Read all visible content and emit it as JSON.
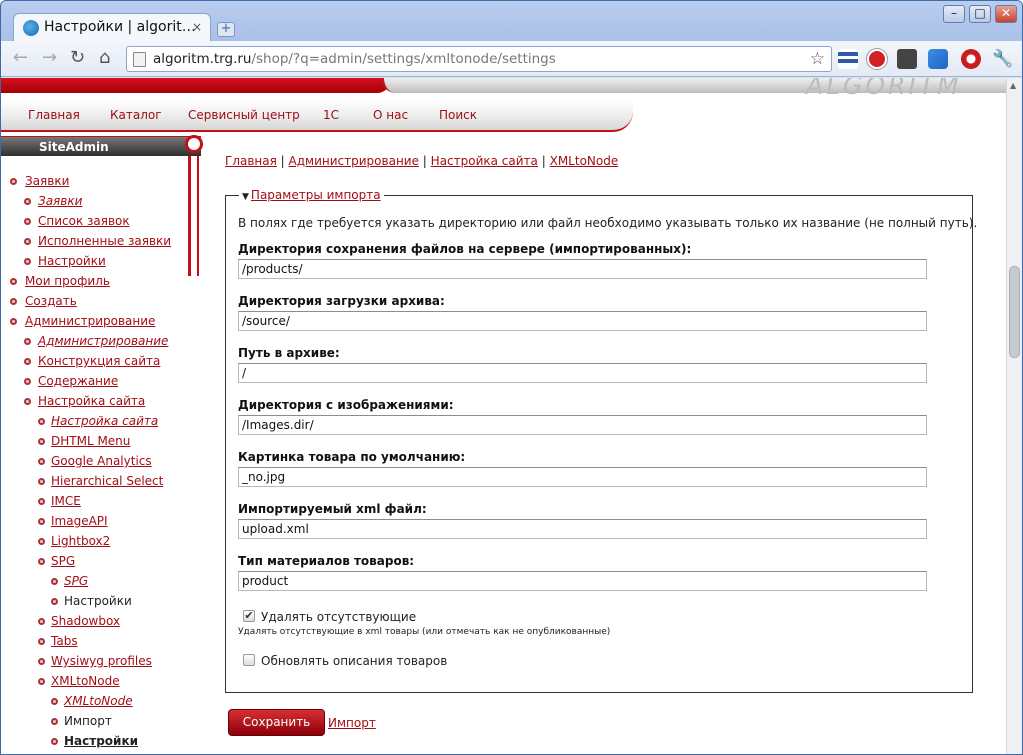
{
  "browser": {
    "tab_title": "Настройки | algorit…",
    "tab_close": "×",
    "new_tab": "+",
    "url_host": "algoritm.trg.ru",
    "url_path": "/shop/?q=admin/settings/xmltonode/settings",
    "window_controls": [
      "minimize-icon",
      "maximize-icon",
      "close-icon"
    ],
    "nav_icons": [
      "back-icon",
      "forward-icon",
      "reload-icon",
      "home-icon"
    ],
    "extension_icons": [
      "menu-bars-icon",
      "adblock-icon",
      "camera-icon",
      "dropbox-icon",
      "opera-icon",
      "wrench-icon"
    ]
  },
  "site": {
    "logo_text": "ALGORITM",
    "menu": [
      "Главная",
      "Каталог",
      "Сервисный центр",
      "1С",
      "О нас",
      "Поиск"
    ]
  },
  "sidebar": {
    "title": "SiteAdmin",
    "items": [
      {
        "label": "Заявки",
        "level": 0,
        "style": "normal"
      },
      {
        "label": "Заявки",
        "level": 1,
        "style": "italic"
      },
      {
        "label": "Список заявок",
        "level": 1,
        "style": "normal"
      },
      {
        "label": "Исполненные заявки",
        "level": 1,
        "style": "normal"
      },
      {
        "label": "Настройки",
        "level": 1,
        "style": "normal"
      },
      {
        "label": "Мои профиль",
        "level": 0,
        "style": "normal"
      },
      {
        "label": "Создать",
        "level": 0,
        "style": "normal"
      },
      {
        "label": "Администрирование",
        "level": 0,
        "style": "normal"
      },
      {
        "label": "Администрирование",
        "level": 1,
        "style": "italic"
      },
      {
        "label": "Конструкция сайта",
        "level": 1,
        "style": "normal"
      },
      {
        "label": "Содержание",
        "level": 1,
        "style": "normal"
      },
      {
        "label": "Настройка сайта",
        "level": 1,
        "style": "normal"
      },
      {
        "label": "Настройка сайта",
        "level": 2,
        "style": "italic"
      },
      {
        "label": "DHTML Menu",
        "level": 2,
        "style": "normal"
      },
      {
        "label": "Google Analytics",
        "level": 2,
        "style": "normal"
      },
      {
        "label": "Hierarchical Select",
        "level": 2,
        "style": "normal"
      },
      {
        "label": "IMCE",
        "level": 2,
        "style": "normal"
      },
      {
        "label": "ImageAPI",
        "level": 2,
        "style": "normal"
      },
      {
        "label": "Lightbox2",
        "level": 2,
        "style": "normal"
      },
      {
        "label": "SPG",
        "level": 2,
        "style": "normal"
      },
      {
        "label": "SPG",
        "level": 3,
        "style": "italic"
      },
      {
        "label": "Настройки",
        "level": 3,
        "style": "plain"
      },
      {
        "label": "Shadowbox",
        "level": 2,
        "style": "normal"
      },
      {
        "label": "Tabs",
        "level": 2,
        "style": "normal"
      },
      {
        "label": "Wysiwyg profiles",
        "level": 2,
        "style": "normal"
      },
      {
        "label": "XMLtoNode",
        "level": 2,
        "style": "normal"
      },
      {
        "label": "XMLtoNode",
        "level": 3,
        "style": "italic"
      },
      {
        "label": "Импорт",
        "level": 3,
        "style": "plain"
      },
      {
        "label": "Настройки",
        "level": 3,
        "style": "active"
      }
    ]
  },
  "breadcrumb": [
    "Главная",
    "Администрирование",
    "Настройка сайта",
    "XMLtoNode"
  ],
  "breadcrumb_sep": "|",
  "form": {
    "legend": "Параметры импорта",
    "intro": "В полях где требуется указать директорию или файл необходимо указывать только их название (не полный путь).",
    "fields": [
      {
        "label": "Директория сохранения файлов на сервере (импортированных):",
        "value": "/products/"
      },
      {
        "label": "Директория загрузки архива:",
        "value": "/source/"
      },
      {
        "label": "Путь в архиве:",
        "value": "/"
      },
      {
        "label": "Директория с изображениями:",
        "value": "/Images.dir/"
      },
      {
        "label": "Картинка товара по умолчанию:",
        "value": "_no.jpg"
      },
      {
        "label": "Импортируемый xml файл:",
        "value": "upload.xml"
      },
      {
        "label": "Тип материалов товаров:",
        "value": "product"
      }
    ],
    "delete_missing": {
      "label": "Удалять отсутствующие",
      "checked": true,
      "description": "Удалять отсутствующие в xml товары (или отмечать как не опубликованные)"
    },
    "update_desc": {
      "label": "Обновлять описания товаров",
      "checked": false
    },
    "save_label": "Сохранить",
    "import_link": "Импорт"
  }
}
